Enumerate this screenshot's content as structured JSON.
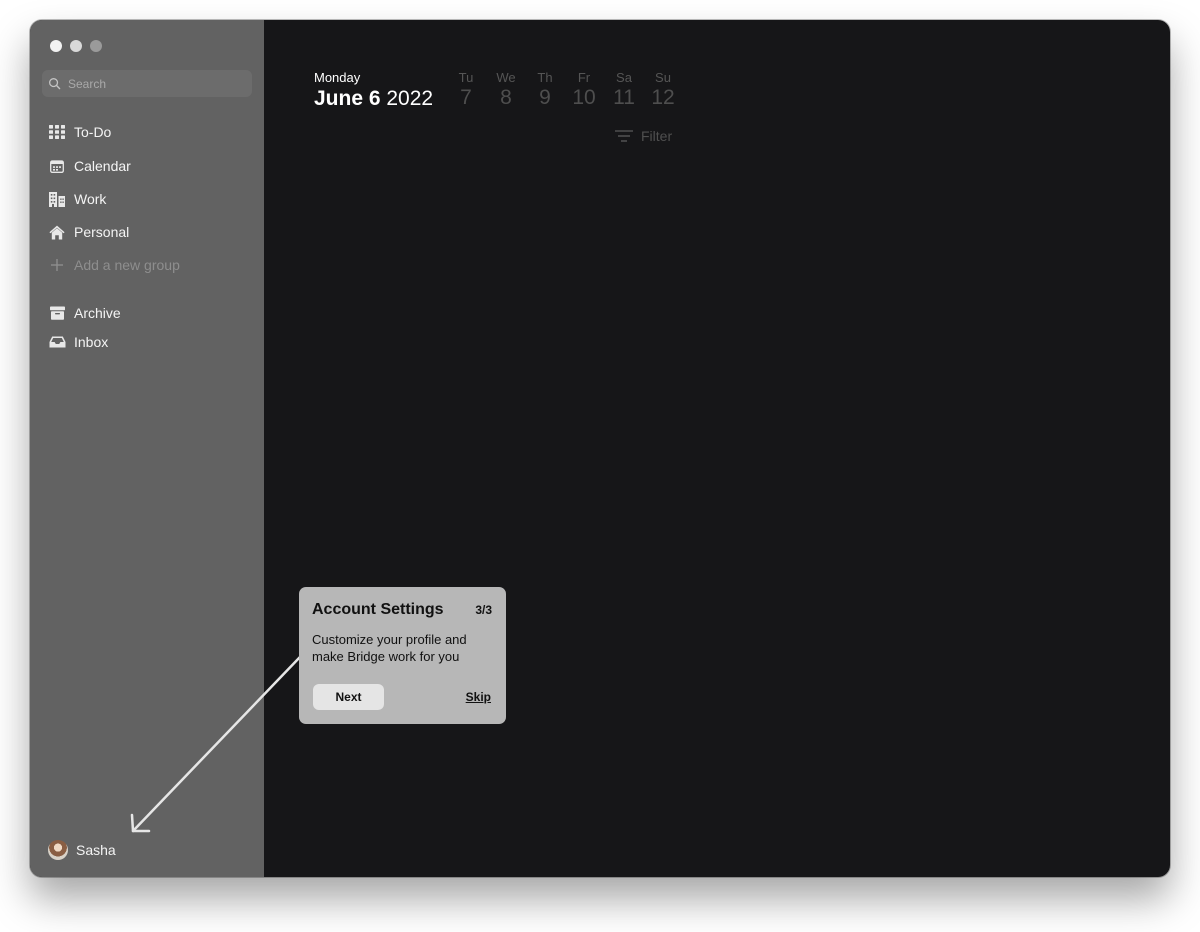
{
  "sidebar": {
    "search": {
      "placeholder": "Search"
    },
    "items": [
      {
        "label": "To-Do",
        "icon": "grid-icon"
      },
      {
        "label": "Calendar",
        "icon": "calendar-icon"
      },
      {
        "label": "Work",
        "icon": "building-icon"
      },
      {
        "label": "Personal",
        "icon": "home-icon"
      },
      {
        "label": "Add a new group",
        "icon": "plus-icon"
      },
      {
        "label": "Archive",
        "icon": "archive-icon"
      },
      {
        "label": "Inbox",
        "icon": "inbox-icon"
      }
    ],
    "user": {
      "name": "Sasha"
    }
  },
  "header": {
    "weekday": "Monday",
    "month_day": "June 6",
    "year": "2022",
    "week": [
      {
        "day": "Tu",
        "num": "7"
      },
      {
        "day": "We",
        "num": "8"
      },
      {
        "day": "Th",
        "num": "9"
      },
      {
        "day": "Fr",
        "num": "10"
      },
      {
        "day": "Sa",
        "num": "11"
      },
      {
        "day": "Su",
        "num": "12"
      }
    ],
    "filter_label": "Filter"
  },
  "onboarding": {
    "title": "Account Settings",
    "step": "3/3",
    "body_line1": "Customize your profile and",
    "body_line2": "make Bridge work for you",
    "next_label": "Next",
    "skip_label": "Skip"
  },
  "colors": {
    "sidebar_bg": "#626262",
    "main_bg": "#161618",
    "tooltip_bg": "#b7b7b7"
  }
}
